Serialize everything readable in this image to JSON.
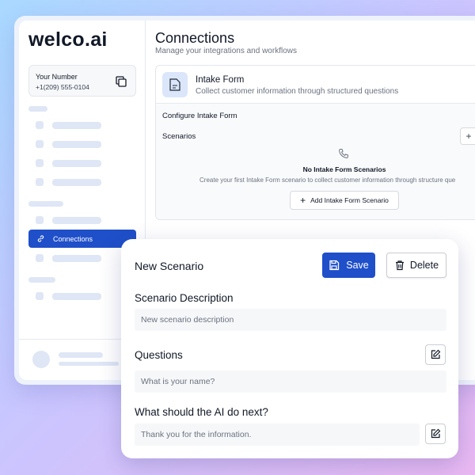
{
  "sidebar": {
    "logo": "welco.ai",
    "number_label": "Your Number",
    "number_value": "+1(209) 555-0104",
    "active_item": "Connections"
  },
  "header": {
    "title": "Connections",
    "subtitle": "Manage your integrations and workflows"
  },
  "panel": {
    "title": "Intake Form",
    "description": "Collect customer information through structured questions",
    "configure_label": "Configure Intake Form",
    "scenarios_label": "Scenarios",
    "empty_title": "No Intake Form Scenarios",
    "empty_description": "Create your first Intake Form scenario to collect customer information through structure que",
    "add_button": "Add Intake Form Scenario"
  },
  "scenario_card": {
    "title": "New Scenario",
    "save_label": "Save",
    "delete_label": "Delete",
    "description_label": "Scenario Description",
    "description_placeholder": "New scenario description",
    "questions_label": "Questions",
    "question_placeholder": "What is your name?",
    "next_label": "What should the AI do next?",
    "next_placeholder": "Thank you for the information."
  },
  "colors": {
    "accent": "#1f4fc9",
    "skeleton": "#dfe6f5"
  },
  "icons": [
    "copy-icon",
    "link-icon",
    "form-icon",
    "phone-icon",
    "plus-icon",
    "save-icon",
    "trash-icon",
    "edit-icon"
  ]
}
